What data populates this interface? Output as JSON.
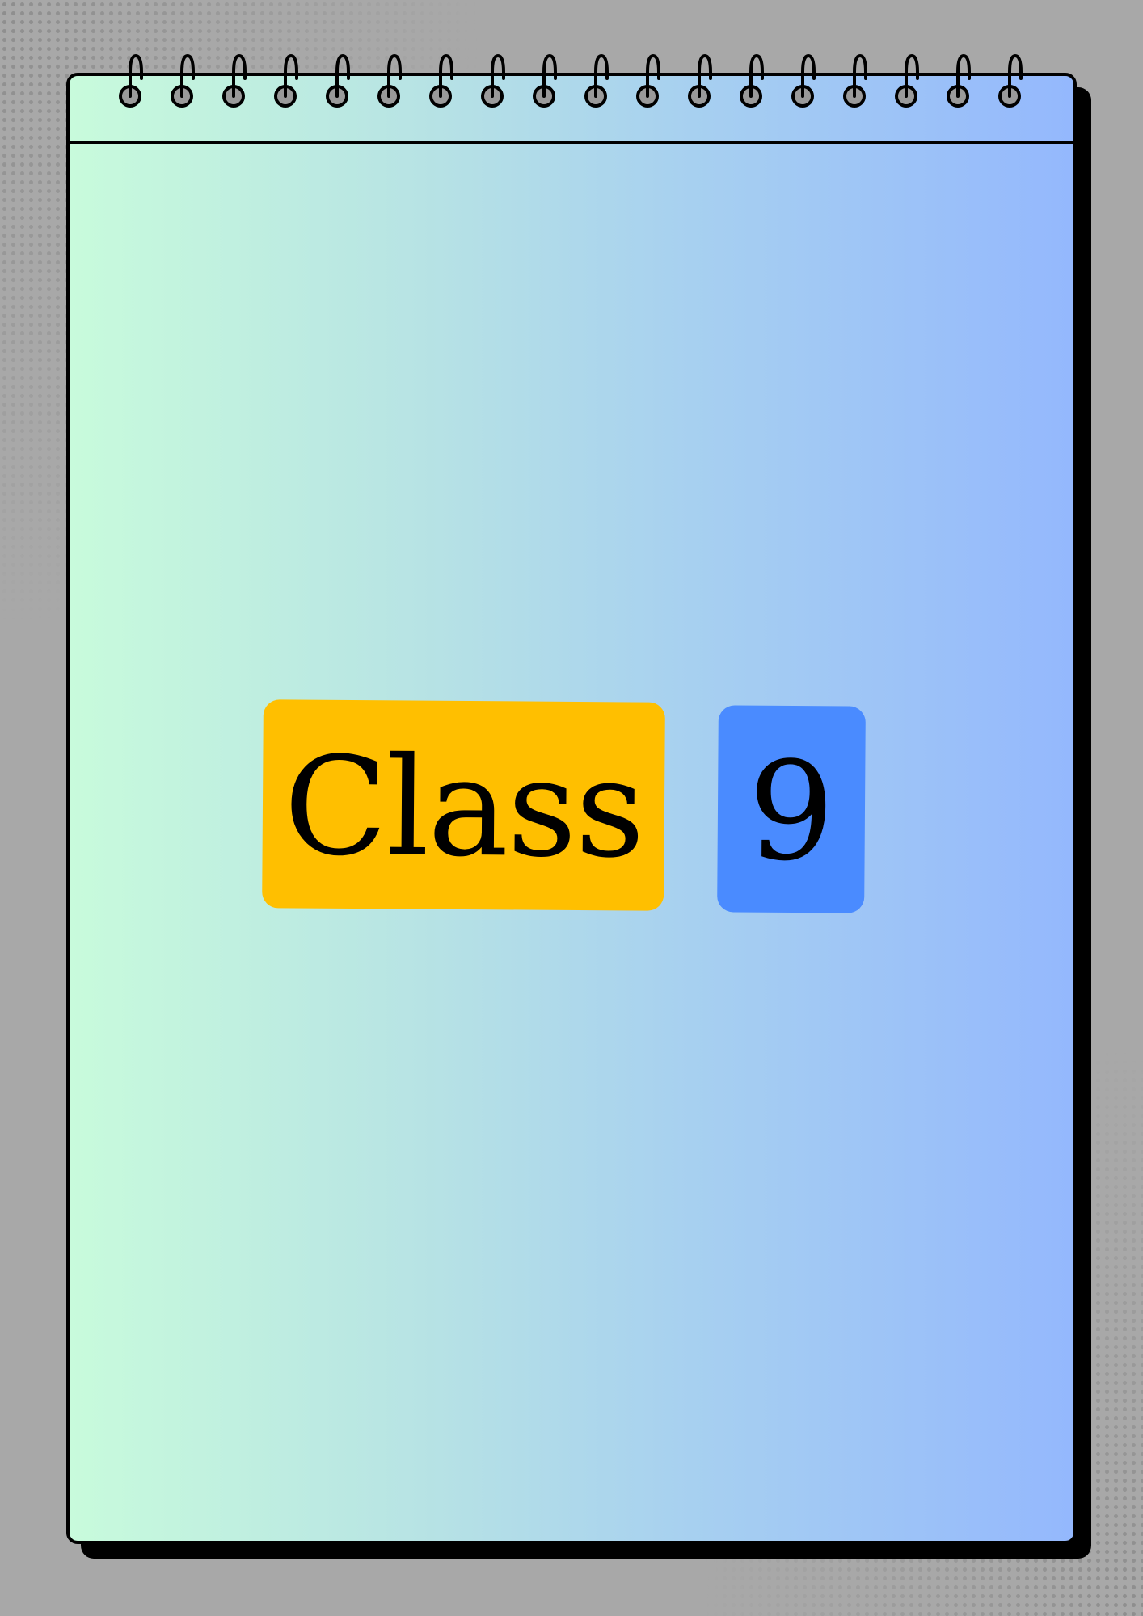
{
  "cover": {
    "title": "Class",
    "number": "9"
  },
  "colors": {
    "background": "#a8a8a8",
    "gradient_start": "#c8fbdc",
    "gradient_end": "#94b8fd",
    "class_tag": "#ffbf00",
    "number_tag": "#4a8bff",
    "outline": "#000000"
  }
}
